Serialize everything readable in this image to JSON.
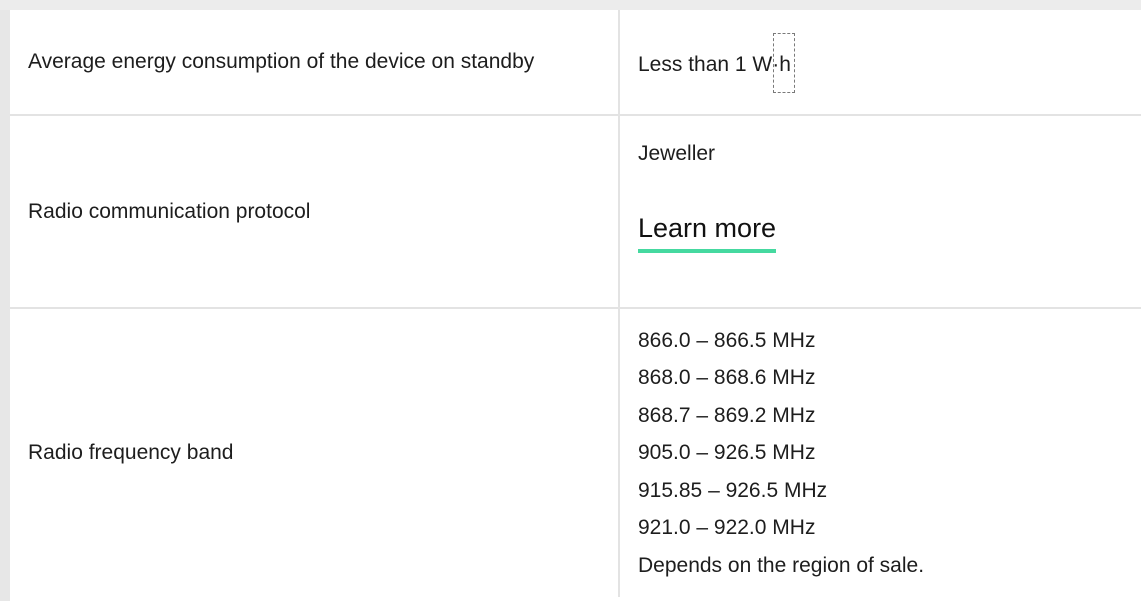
{
  "rows": [
    {
      "label": "Average energy consumption of the device on standby",
      "value_text": "Less than 1 W·",
      "value_unit": "h"
    },
    {
      "label": "Radio communication protocol",
      "protocol": "Jeweller",
      "link_label": "Learn more"
    },
    {
      "label": "Radio frequency band",
      "bands": [
        "866.0 – 866.5 MHz",
        "868.0 – 868.6 MHz",
        "868.7 – 869.2 MHz",
        "905.0 – 926.5 MHz",
        "915.85 – 926.5 MHz",
        "921.0 – 922.0 MHz",
        "Depends on the region of sale."
      ]
    }
  ],
  "colors": {
    "link_underline": "#45d9a0",
    "grid_line": "#e3e3e3",
    "text": "#1d1d1d"
  }
}
